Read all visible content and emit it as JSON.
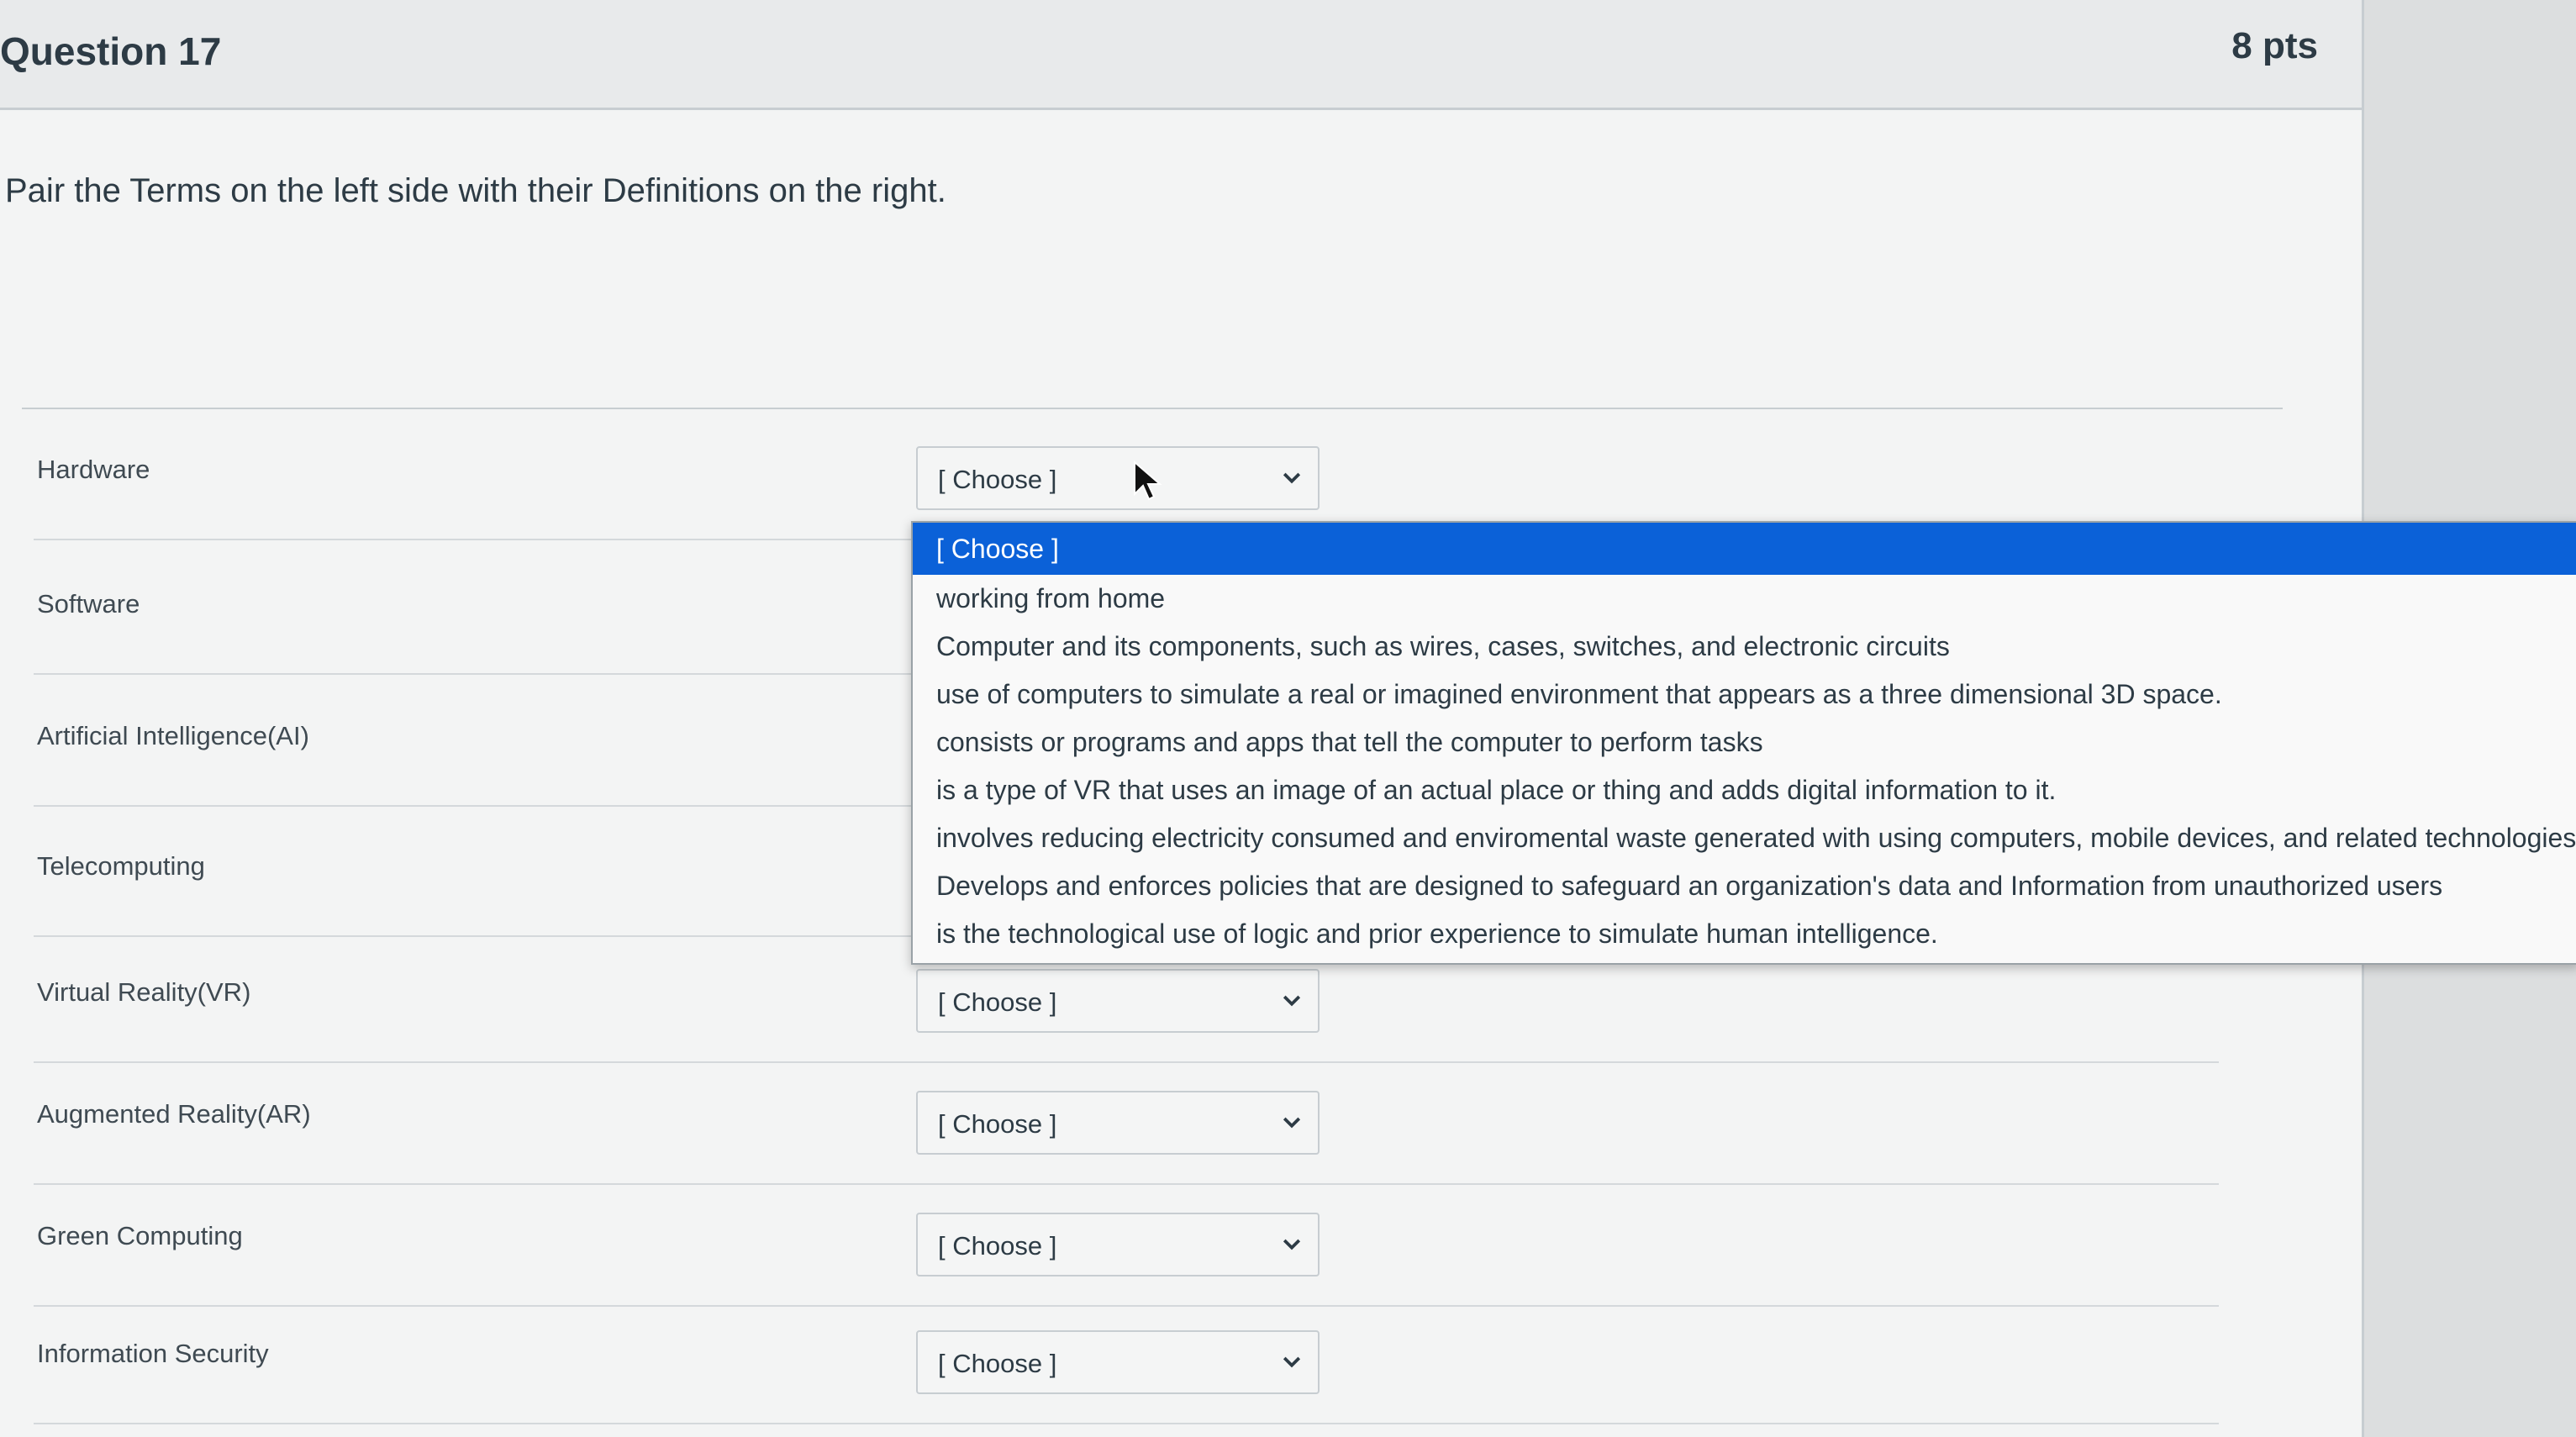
{
  "question": {
    "title": "Question 17",
    "points": "8 pts",
    "prompt": "Pair the Terms on the left side with their Definitions on the right."
  },
  "terms": [
    {
      "label": "Hardware",
      "selected": "[ Choose ]"
    },
    {
      "label": "Software",
      "selected": ""
    },
    {
      "label": "Artificial Intelligence(AI)",
      "selected": ""
    },
    {
      "label": "Telecomputing",
      "selected": ""
    },
    {
      "label": "Virtual Reality(VR)",
      "selected": "[ Choose ]"
    },
    {
      "label": "Augmented Reality(AR)",
      "selected": "[ Choose ]"
    },
    {
      "label": "Green Computing",
      "selected": "[ Choose ]"
    },
    {
      "label": "Information Security",
      "selected": "[ Choose ]"
    }
  ],
  "dropdown_options": [
    "[ Choose ]",
    "working from home",
    "Computer and its components, such as wires, cases, switches, and electronic circuits",
    "use of computers to simulate a real or imagined environment that appears as a three dimensional 3D space.",
    "consists or programs and apps that tell the computer to perform tasks",
    "is a type of VR that uses an image of an actual place or thing and adds digital information to it.",
    "involves reducing electricity consumed and enviromental waste generated with using computers, mobile devices, and related technologies",
    "Develops and enforces policies that are designed to safeguard an organization's data and Information from unauthorized users",
    "is the technological use of logic and prior experience to simulate human intelligence."
  ],
  "dropdown_selected_index": 0,
  "icons": {
    "select_arrow": "chevron-down-icon",
    "pointer": "mouse-pointer-icon"
  },
  "colors": {
    "selected_option_background": "#0b61d8",
    "selected_option_text": "#ffffff",
    "page_background": "#f3f4f4"
  }
}
